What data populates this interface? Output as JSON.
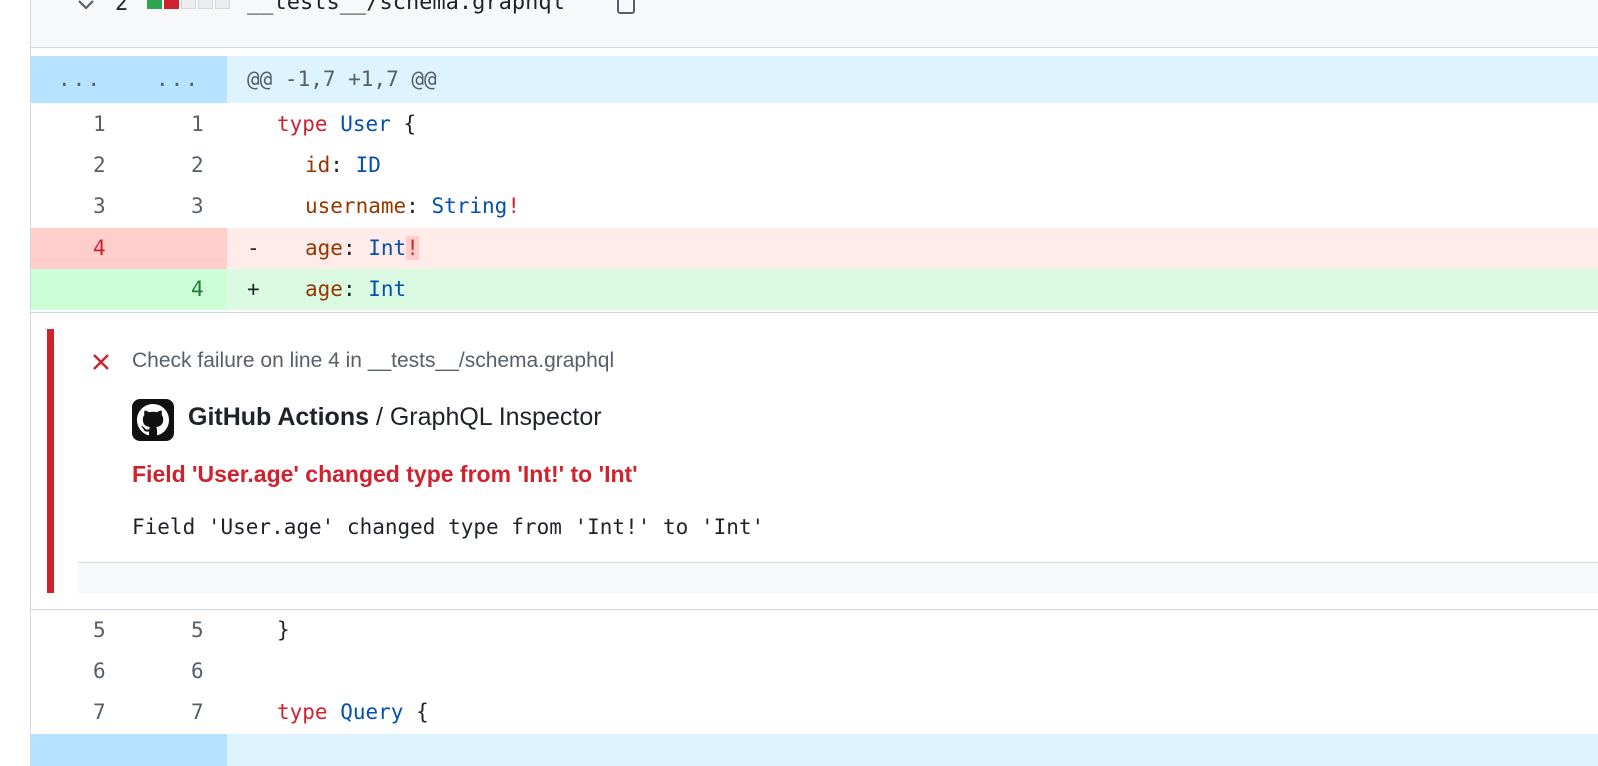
{
  "file": {
    "changes": "2",
    "path": "__tests__/schema.graphql",
    "diffstat_colors": [
      "#2da44e",
      "#cf222e",
      "#ebeef1",
      "#ebeef1",
      "#ebeef1"
    ]
  },
  "hunk": {
    "old_marker": "...",
    "new_marker": "...",
    "header": "@@ -1,7 +1,7 @@"
  },
  "lines": [
    {
      "old": "1",
      "new": "1",
      "type": "ctx"
    },
    {
      "old": "2",
      "new": "2",
      "type": "ctx"
    },
    {
      "old": "3",
      "new": "3",
      "type": "ctx"
    },
    {
      "old": "4",
      "new": "",
      "type": "del",
      "marker": "-"
    },
    {
      "old": "",
      "new": "4",
      "type": "add",
      "marker": "+"
    },
    {
      "old": "5",
      "new": "5",
      "type": "ctx"
    },
    {
      "old": "6",
      "new": "6",
      "type": "ctx"
    },
    {
      "old": "7",
      "new": "7",
      "type": "ctx"
    }
  ],
  "code": {
    "kw_type": "type",
    "user": "User",
    "brace_open": "{",
    "id_field": "id",
    "id_type": "ID",
    "username_field": "username",
    "string_type": "String",
    "bang": "!",
    "age_field": "age",
    "int_type": "Int",
    "colon": ":",
    "brace_close": "}",
    "query": "Query"
  },
  "annotation": {
    "title": "Check failure on line 4 in __tests__/schema.graphql",
    "source_app": "GitHub Actions",
    "source_sep": " / ",
    "source_check": "GraphQL Inspector",
    "message_title": "Field 'User.age' changed type from 'Int!' to 'Int'",
    "message_body": "Field 'User.age' changed type from 'Int!' to 'Int'"
  },
  "colors": {
    "failure": "#cf222e",
    "hunk_bg": "#ddf4ff",
    "del_bg": "#ffebe9",
    "add_bg": "#dafbe1"
  }
}
